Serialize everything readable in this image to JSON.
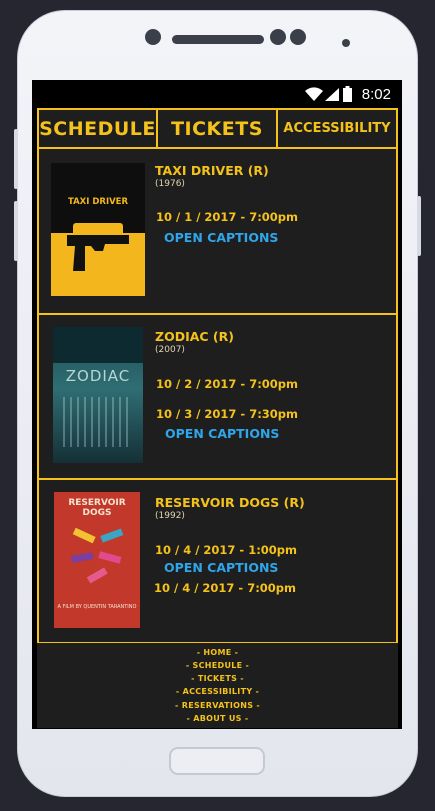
{
  "status_bar": {
    "time": "8:02",
    "icons": [
      "wifi-icon",
      "signal-icon",
      "battery-icon"
    ]
  },
  "nav": {
    "items": [
      {
        "label": "SCHEDULE"
      },
      {
        "label": "TICKETS"
      },
      {
        "label": "ACCESSIBILITY"
      }
    ]
  },
  "films": [
    {
      "title": "TAXI DRIVER  (R)",
      "year": "(1976)",
      "poster_text": "TAXI DRIVER",
      "showings": [
        "10 / 1 / 2017  - 7:00pm"
      ],
      "open_captions": "OPEN CAPTIONS"
    },
    {
      "title": "ZODIAC  (R)",
      "year": "(2007)",
      "poster_text": "ZODIAC",
      "showings": [
        "10 / 2 / 2017  - 7:00pm",
        "10 / 3 / 2017  - 7:30pm"
      ],
      "open_captions": "OPEN CAPTIONS"
    },
    {
      "title": "RESERVOIR DOGS  (R)",
      "year": "(1992)",
      "poster_text": "RESERVOIR DOGS",
      "poster_subtext": "A FILM BY QUENTIN TARANTINO",
      "showings": [
        "10 / 4 / 2017  - 1:00pm",
        "10 / 4 / 2017  - 7:00pm"
      ],
      "open_captions": "OPEN CAPTIONS"
    }
  ],
  "footer": {
    "links": [
      {
        "label": "-  HOME  -"
      },
      {
        "label": "-  SCHEDULE  -"
      },
      {
        "label": "-  TICKETS  -"
      },
      {
        "label": "-  ACCESSIBILITY  -"
      },
      {
        "label": "-  RESERVATIONS  -"
      },
      {
        "label": "-  ABOUT US  -"
      }
    ]
  },
  "colors": {
    "accent": "#f4c21b",
    "caption_blue": "#2fa6ea",
    "background": "#1e1e1e"
  }
}
